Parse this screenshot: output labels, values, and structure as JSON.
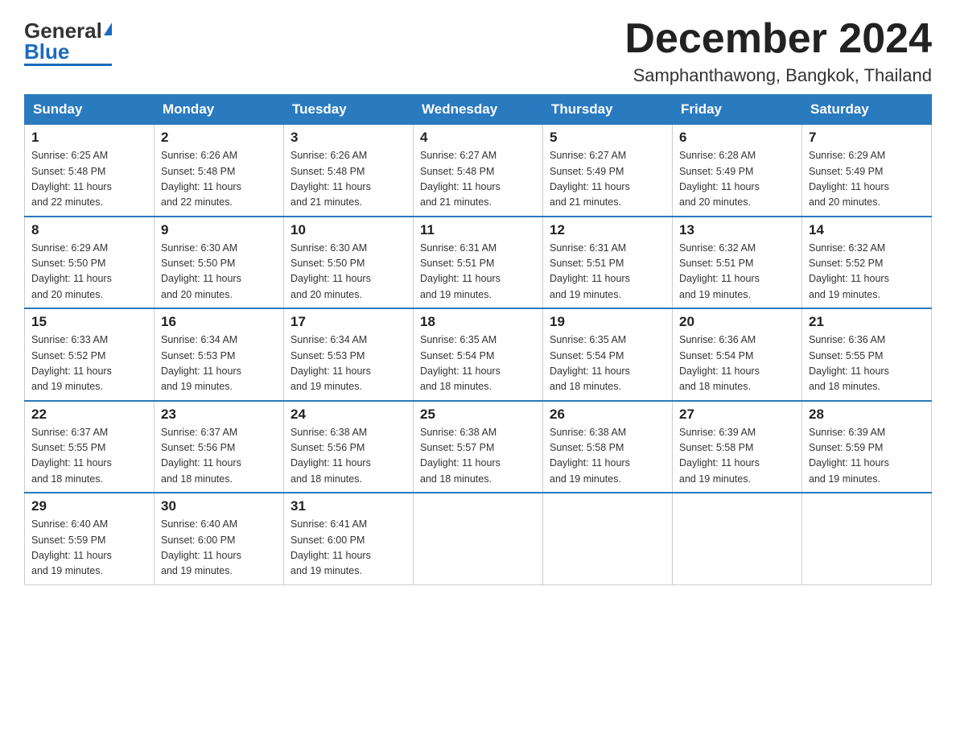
{
  "logo": {
    "general": "General",
    "blue": "Blue"
  },
  "title": "December 2024",
  "location": "Samphanthawong, Bangkok, Thailand",
  "days_of_week": [
    "Sunday",
    "Monday",
    "Tuesday",
    "Wednesday",
    "Thursday",
    "Friday",
    "Saturday"
  ],
  "weeks": [
    [
      {
        "day": "1",
        "sunrise": "6:25 AM",
        "sunset": "5:48 PM",
        "daylight": "11 hours and 22 minutes."
      },
      {
        "day": "2",
        "sunrise": "6:26 AM",
        "sunset": "5:48 PM",
        "daylight": "11 hours and 22 minutes."
      },
      {
        "day": "3",
        "sunrise": "6:26 AM",
        "sunset": "5:48 PM",
        "daylight": "11 hours and 21 minutes."
      },
      {
        "day": "4",
        "sunrise": "6:27 AM",
        "sunset": "5:48 PM",
        "daylight": "11 hours and 21 minutes."
      },
      {
        "day": "5",
        "sunrise": "6:27 AM",
        "sunset": "5:49 PM",
        "daylight": "11 hours and 21 minutes."
      },
      {
        "day": "6",
        "sunrise": "6:28 AM",
        "sunset": "5:49 PM",
        "daylight": "11 hours and 20 minutes."
      },
      {
        "day": "7",
        "sunrise": "6:29 AM",
        "sunset": "5:49 PM",
        "daylight": "11 hours and 20 minutes."
      }
    ],
    [
      {
        "day": "8",
        "sunrise": "6:29 AM",
        "sunset": "5:50 PM",
        "daylight": "11 hours and 20 minutes."
      },
      {
        "day": "9",
        "sunrise": "6:30 AM",
        "sunset": "5:50 PM",
        "daylight": "11 hours and 20 minutes."
      },
      {
        "day": "10",
        "sunrise": "6:30 AM",
        "sunset": "5:50 PM",
        "daylight": "11 hours and 20 minutes."
      },
      {
        "day": "11",
        "sunrise": "6:31 AM",
        "sunset": "5:51 PM",
        "daylight": "11 hours and 19 minutes."
      },
      {
        "day": "12",
        "sunrise": "6:31 AM",
        "sunset": "5:51 PM",
        "daylight": "11 hours and 19 minutes."
      },
      {
        "day": "13",
        "sunrise": "6:32 AM",
        "sunset": "5:51 PM",
        "daylight": "11 hours and 19 minutes."
      },
      {
        "day": "14",
        "sunrise": "6:32 AM",
        "sunset": "5:52 PM",
        "daylight": "11 hours and 19 minutes."
      }
    ],
    [
      {
        "day": "15",
        "sunrise": "6:33 AM",
        "sunset": "5:52 PM",
        "daylight": "11 hours and 19 minutes."
      },
      {
        "day": "16",
        "sunrise": "6:34 AM",
        "sunset": "5:53 PM",
        "daylight": "11 hours and 19 minutes."
      },
      {
        "day": "17",
        "sunrise": "6:34 AM",
        "sunset": "5:53 PM",
        "daylight": "11 hours and 19 minutes."
      },
      {
        "day": "18",
        "sunrise": "6:35 AM",
        "sunset": "5:54 PM",
        "daylight": "11 hours and 18 minutes."
      },
      {
        "day": "19",
        "sunrise": "6:35 AM",
        "sunset": "5:54 PM",
        "daylight": "11 hours and 18 minutes."
      },
      {
        "day": "20",
        "sunrise": "6:36 AM",
        "sunset": "5:54 PM",
        "daylight": "11 hours and 18 minutes."
      },
      {
        "day": "21",
        "sunrise": "6:36 AM",
        "sunset": "5:55 PM",
        "daylight": "11 hours and 18 minutes."
      }
    ],
    [
      {
        "day": "22",
        "sunrise": "6:37 AM",
        "sunset": "5:55 PM",
        "daylight": "11 hours and 18 minutes."
      },
      {
        "day": "23",
        "sunrise": "6:37 AM",
        "sunset": "5:56 PM",
        "daylight": "11 hours and 18 minutes."
      },
      {
        "day": "24",
        "sunrise": "6:38 AM",
        "sunset": "5:56 PM",
        "daylight": "11 hours and 18 minutes."
      },
      {
        "day": "25",
        "sunrise": "6:38 AM",
        "sunset": "5:57 PM",
        "daylight": "11 hours and 18 minutes."
      },
      {
        "day": "26",
        "sunrise": "6:38 AM",
        "sunset": "5:58 PM",
        "daylight": "11 hours and 19 minutes."
      },
      {
        "day": "27",
        "sunrise": "6:39 AM",
        "sunset": "5:58 PM",
        "daylight": "11 hours and 19 minutes."
      },
      {
        "day": "28",
        "sunrise": "6:39 AM",
        "sunset": "5:59 PM",
        "daylight": "11 hours and 19 minutes."
      }
    ],
    [
      {
        "day": "29",
        "sunrise": "6:40 AM",
        "sunset": "5:59 PM",
        "daylight": "11 hours and 19 minutes."
      },
      {
        "day": "30",
        "sunrise": "6:40 AM",
        "sunset": "6:00 PM",
        "daylight": "11 hours and 19 minutes."
      },
      {
        "day": "31",
        "sunrise": "6:41 AM",
        "sunset": "6:00 PM",
        "daylight": "11 hours and 19 minutes."
      },
      null,
      null,
      null,
      null
    ]
  ],
  "cell_labels": {
    "sunrise": "Sunrise:",
    "sunset": "Sunset:",
    "daylight": "Daylight:"
  }
}
